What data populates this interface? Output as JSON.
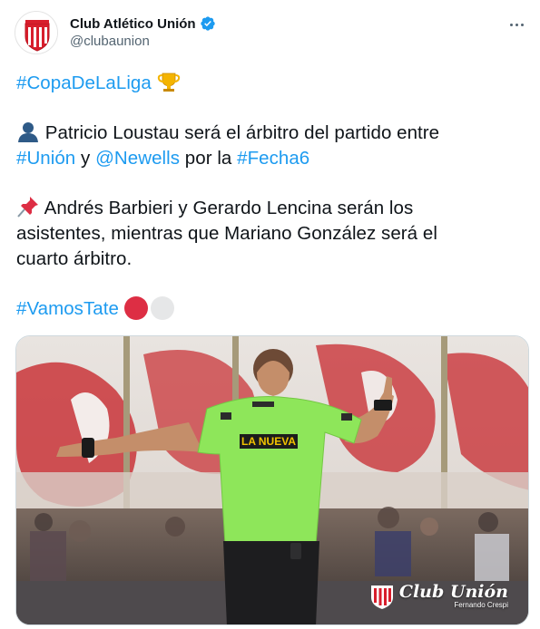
{
  "author": {
    "display_name": "Club Atlético Unión",
    "handle": "@clubaunion",
    "verified_icon": "verified-badge-icon",
    "avatar": "club-crest-avatar"
  },
  "menu": {
    "icon": "more-options-icon"
  },
  "tweet": {
    "line1": {
      "hashtag": "#CopaDeLaLiga",
      "emoji": "trophy-icon"
    },
    "line2": {
      "emoji": "person-silhouette-icon",
      "text": " Patricio Loustau será el árbitro del partido entre"
    },
    "line3": {
      "hashtag_union": "#Unión",
      "y": " y ",
      "mention": "@Newells",
      "por_la": " por la ",
      "hashtag_fecha": "#Fecha6"
    },
    "line4": {
      "emoji": "pushpin-icon",
      "text": " Andrés Barbieri y Gerardo Lencina serán los"
    },
    "line5": "asistentes, mientras que Mariano González será el",
    "line6": "cuarto árbitro.",
    "line7": {
      "hashtag": "#VamosTate",
      "emoji_red": "red-circle-icon",
      "emoji_white": "white-circle-icon"
    }
  },
  "media": {
    "jersey_text": "LA NUEVA",
    "watermark_club": "Club Unión",
    "watermark_credit": "Fernando Crespi"
  },
  "colors": {
    "link": "#1d9bf0",
    "text": "#0f1419",
    "secondary": "#536471",
    "referee_shirt": "#8ee65a",
    "union_red": "#d81e2c"
  }
}
